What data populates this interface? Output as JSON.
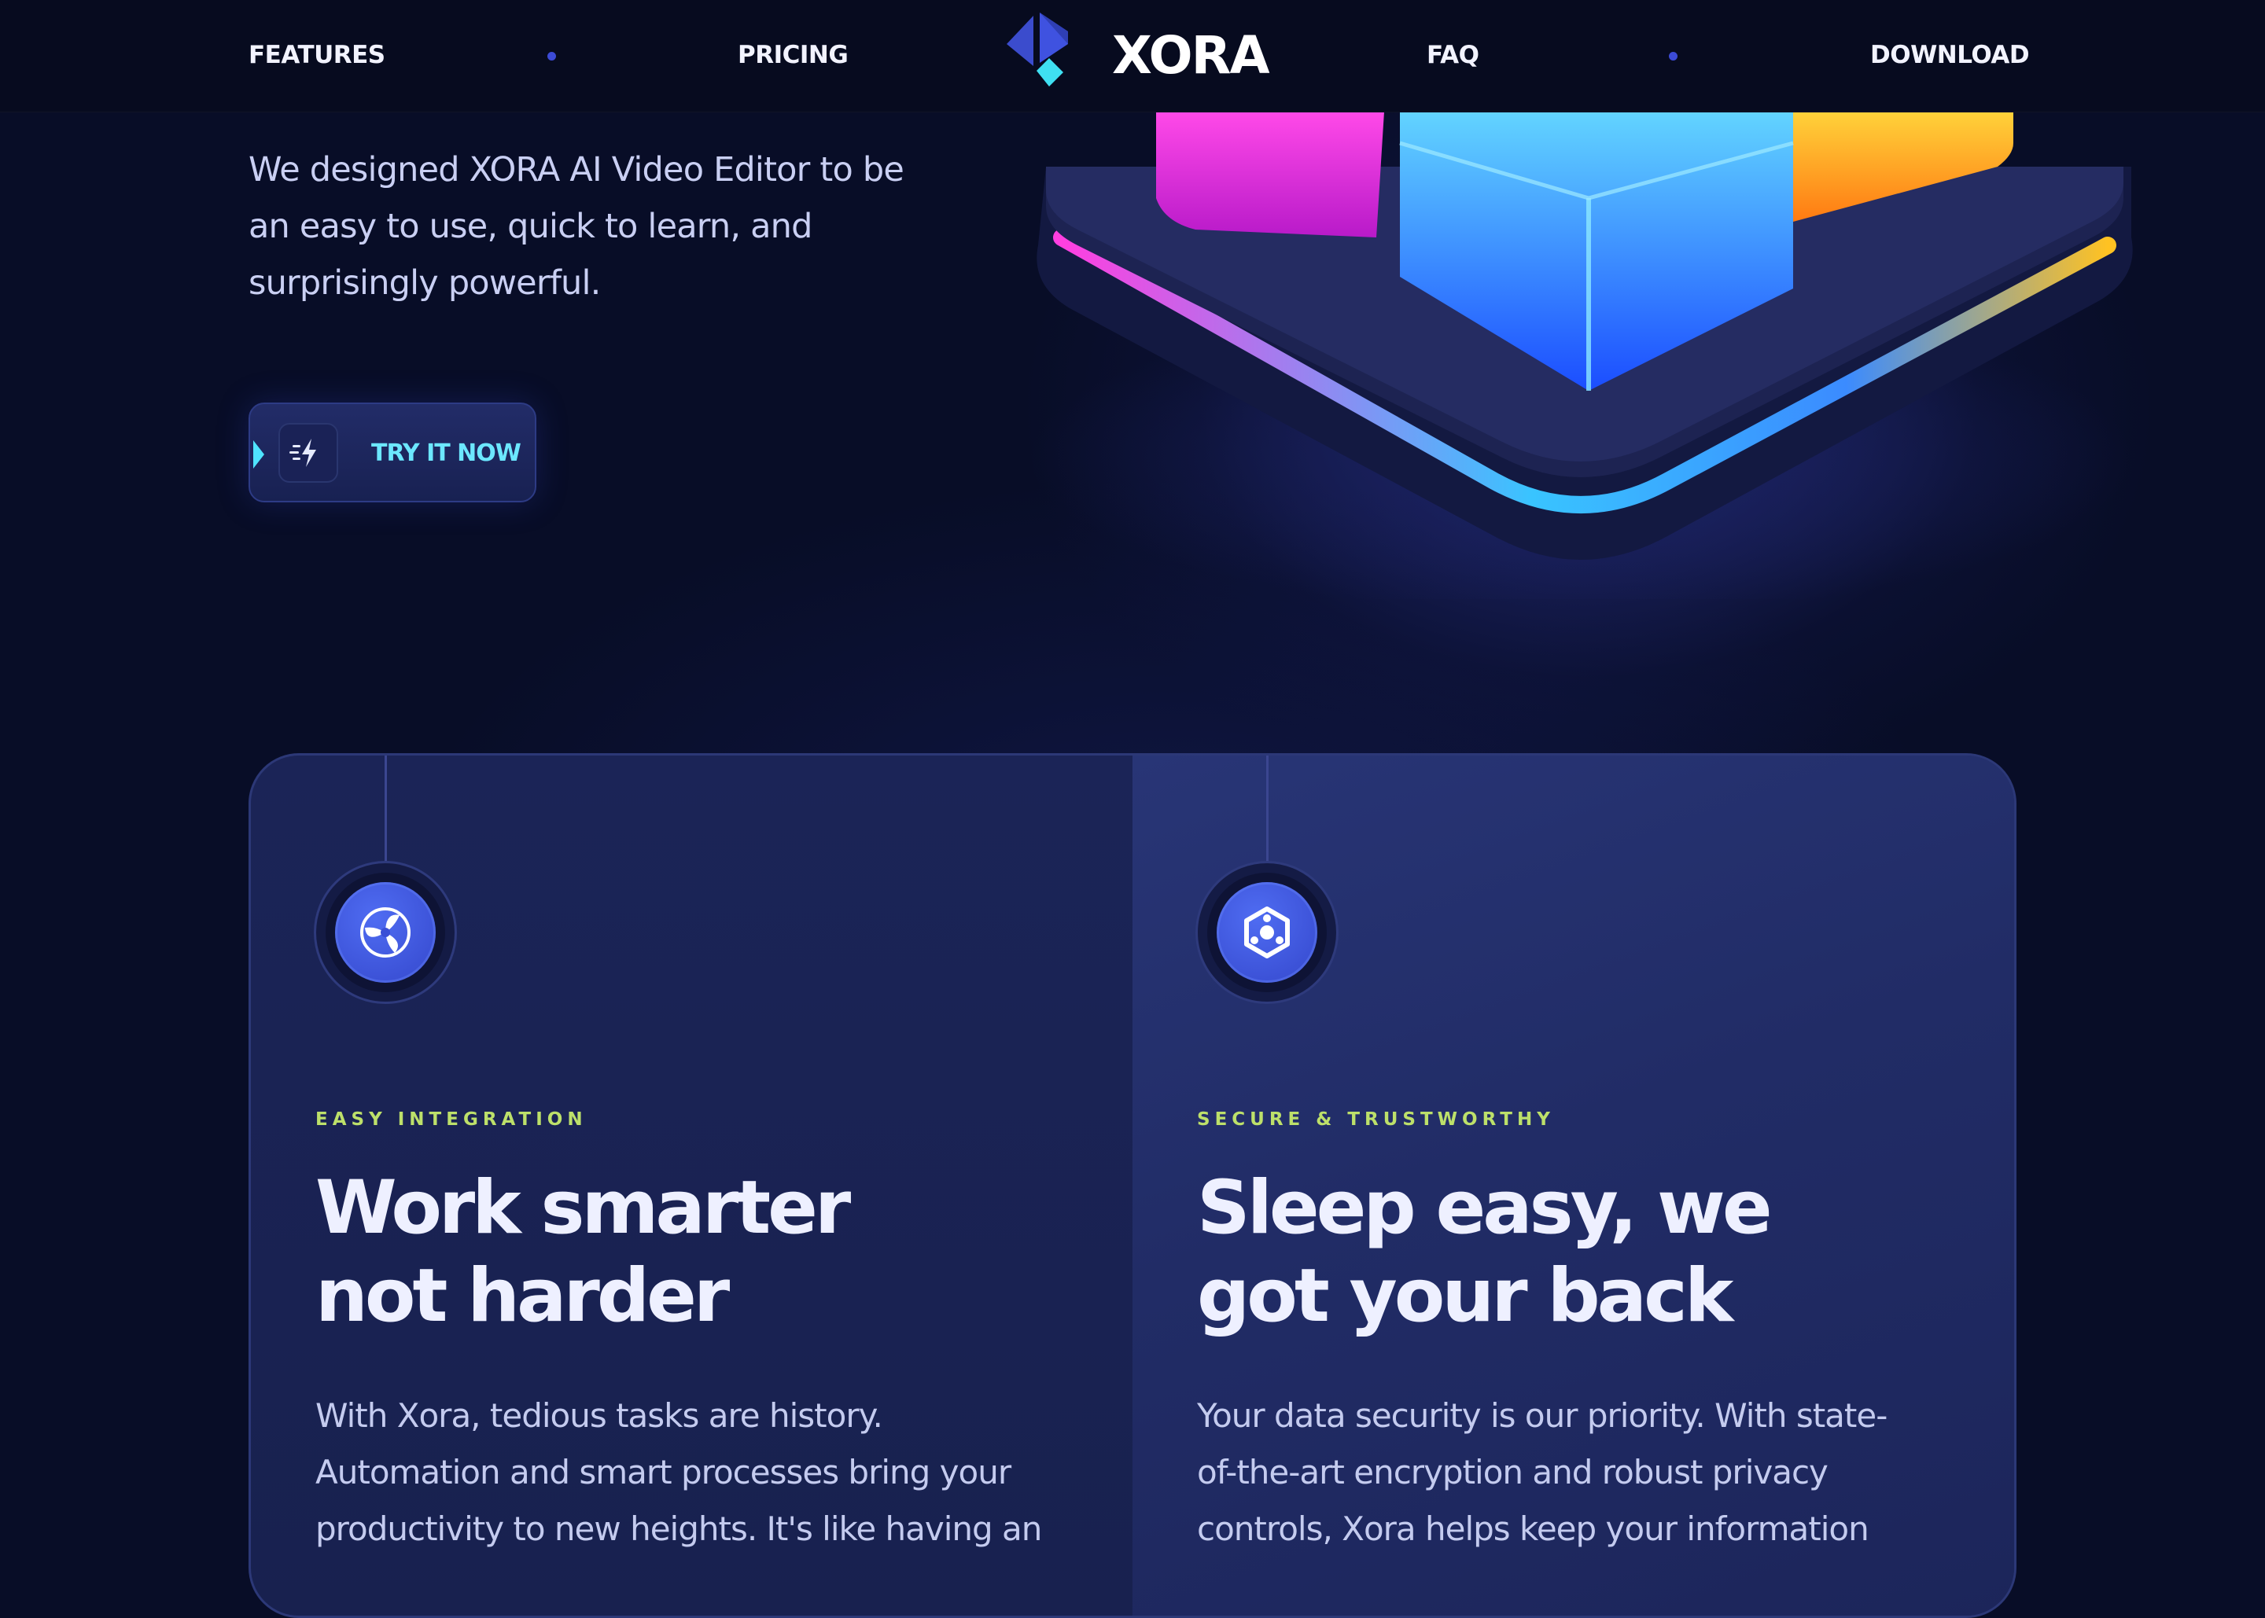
{
  "nav": {
    "links": [
      "FEATURES",
      "PRICING",
      "FAQ",
      "DOWNLOAD"
    ],
    "brand": "XORA"
  },
  "hero": {
    "description_lines": [
      "We designed XORA AI Video Editor to be",
      "an easy to use, quick to learn, and",
      "surprisingly powerful."
    ],
    "cta_label": "TRY IT NOW"
  },
  "features": [
    {
      "eyebrow": "EASY INTEGRATION",
      "title_lines": [
        "Work smarter",
        "not harder"
      ],
      "body_lines": [
        "With Xora, tedious tasks are history.",
        "Automation and smart processes bring your",
        "productivity to new heights. It's like having an"
      ],
      "icon": "fan-swirl-icon"
    },
    {
      "eyebrow": "SECURE & TRUSTWORTHY",
      "title_lines": [
        "Sleep easy, we",
        "got your back"
      ],
      "body_lines": [
        "Your data security is our priority. With state-",
        "of-the-art encryption and robust privacy",
        "controls, Xora helps keep your information"
      ],
      "icon": "hexagon-shield-icon"
    }
  ],
  "colors": {
    "background": "#080d27",
    "accent": "#3c4bd6",
    "cta_text": "#6ce7ff",
    "eyebrow": "#bde06a"
  }
}
